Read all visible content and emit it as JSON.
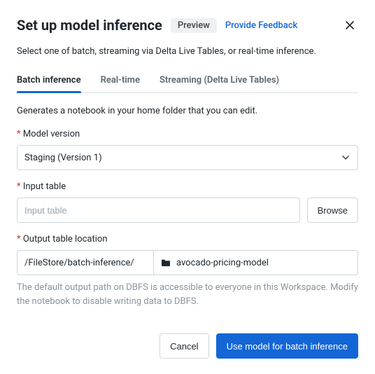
{
  "header": {
    "title": "Set up model inference",
    "badge": "Preview",
    "feedback": "Provide Feedback"
  },
  "subtitle": "Select one of batch, streaming via Delta Live Tables, or real-time inference.",
  "tabs": {
    "batch": "Batch inference",
    "realtime": "Real-time",
    "streaming": "Streaming (Delta Live Tables)"
  },
  "desc": "Generates a notebook in your home folder that you can edit.",
  "fields": {
    "model_version": {
      "label": "Model version",
      "value": "Staging (Version 1)"
    },
    "input_table": {
      "label": "Input table",
      "placeholder": "Input table",
      "browse": "Browse"
    },
    "output": {
      "label": "Output table location",
      "prefix": "/FileStore/batch-inference/",
      "value": "avocado-pricing-model",
      "hint": "The default output path on DBFS is accessible to everyone in this Workspace. Modify the notebook to disable writing data to DBFS."
    }
  },
  "footer": {
    "cancel": "Cancel",
    "submit": "Use model for batch inference"
  }
}
